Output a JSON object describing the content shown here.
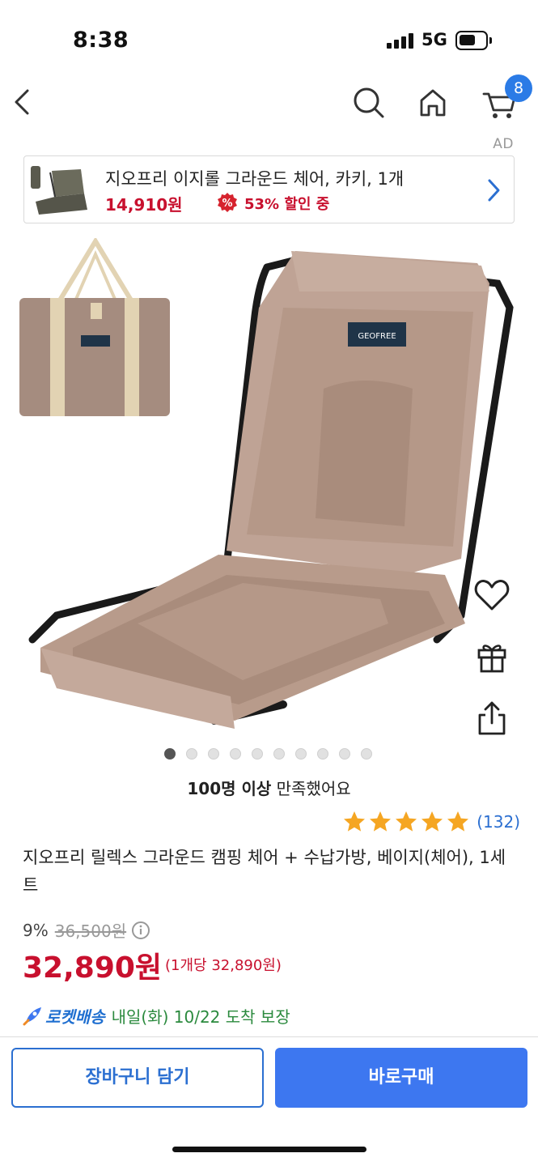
{
  "status_bar": {
    "time": "8:38",
    "network": "5G"
  },
  "nav": {
    "cart_count": "8"
  },
  "ad": {
    "label": "AD",
    "title": "지오프리 이지롤 그라운드 체어, 카키, 1개",
    "price": "14,910원",
    "discount": "53% 할인 중"
  },
  "gallery": {
    "image_count": 10,
    "active_index": 0
  },
  "satisfaction": {
    "bold": "100명 이상",
    "rest": " 만족했어요"
  },
  "rating": {
    "stars": 5,
    "count": "(132)"
  },
  "product": {
    "title": "지오프리 릴렉스 그라운드 캠핑 체어 + 수납가방, 베이지(체어), 1세트",
    "discount_rate": "9%",
    "original_price": "36,500원",
    "sale_price": "32,890원",
    "unit_price": "(1개당 32,890원)"
  },
  "delivery": {
    "label": "로켓배송",
    "text": "내일(화) 10/22 도착 보장"
  },
  "buttons": {
    "cart": "장바구니 담기",
    "buy": "바로구매"
  },
  "colors": {
    "accent_blue": "#3d77f0",
    "price_red": "#c8102e",
    "star": "#f5a623"
  }
}
